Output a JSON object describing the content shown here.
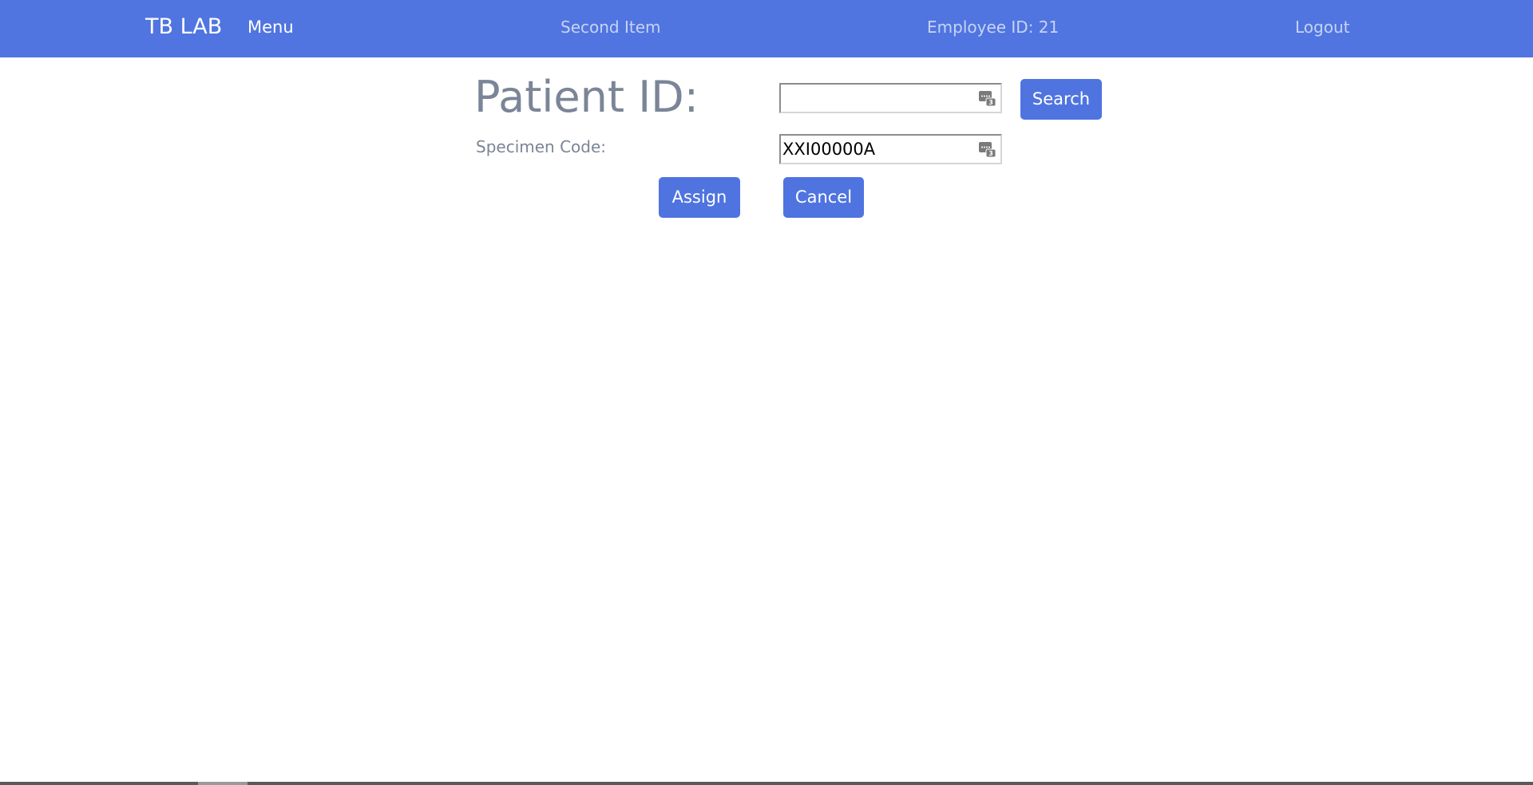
{
  "navbar": {
    "brand": "TB LAB",
    "menu_label": "Menu",
    "second_item_label": "Second Item",
    "employee_label": "Employee ID: 21",
    "logout_label": "Logout",
    "background_color": "#5075e0"
  },
  "form": {
    "patient_id_label": "Patient ID:",
    "patient_id_value": "",
    "specimen_code_label": "Specimen Code:",
    "specimen_code_value": "XXI00000A",
    "field_icon": "keyboard-icon",
    "search_button_label": "Search",
    "assign_button_label": "Assign",
    "cancel_button_label": "Cancel",
    "button_color": "#4f74e0",
    "label_color": "#7b8597"
  }
}
